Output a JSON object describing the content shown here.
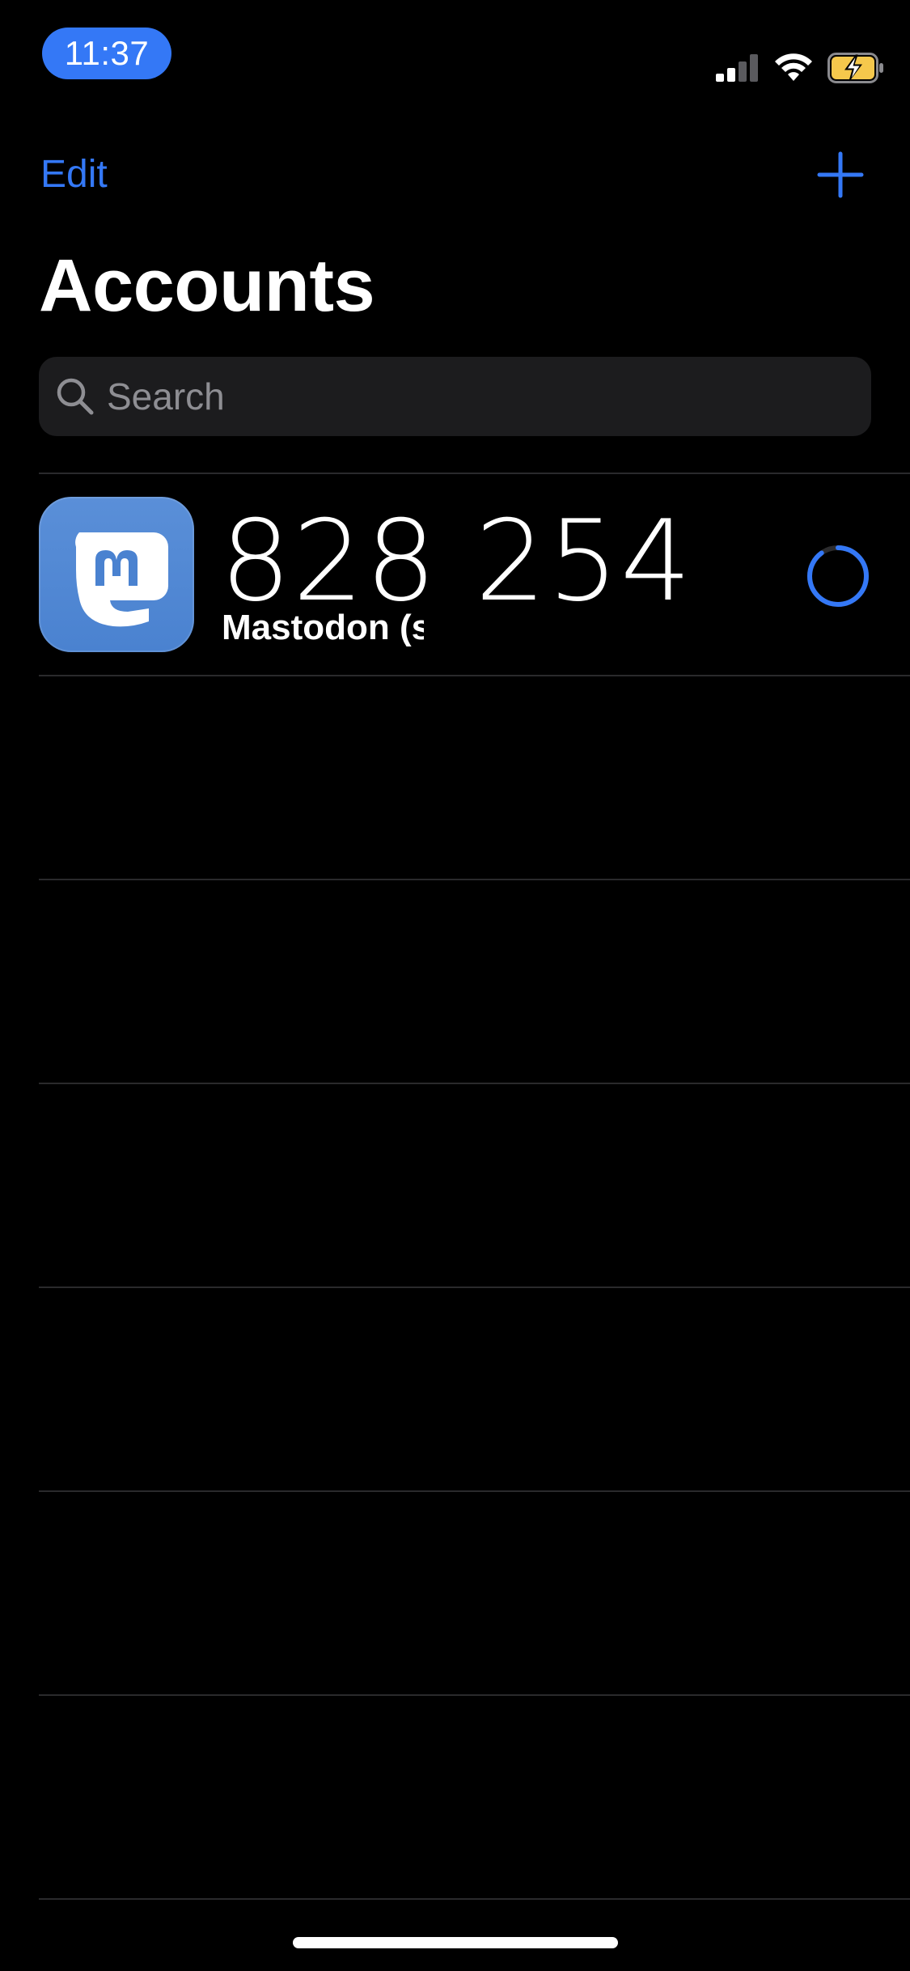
{
  "status_bar": {
    "time": "11:37",
    "icons": [
      "cellular-signal-icon",
      "wifi-icon",
      "battery-charging-icon"
    ],
    "battery_color": "#F5C84C"
  },
  "nav": {
    "edit_label": "Edit",
    "add_icon": "plus-icon"
  },
  "title": "Accounts",
  "search": {
    "placeholder": "Search",
    "value": ""
  },
  "accounts": [
    {
      "icon": "mastodon-app-icon",
      "code": "828 254",
      "name": "Mastodon (s",
      "timer_progress": 0.9
    }
  ],
  "colors": {
    "accent": "#3478F6",
    "background": "#000000",
    "search_background": "#1C1C1E",
    "separator": "#2A2A2C",
    "mastodon_blue": "#4A82D0"
  }
}
